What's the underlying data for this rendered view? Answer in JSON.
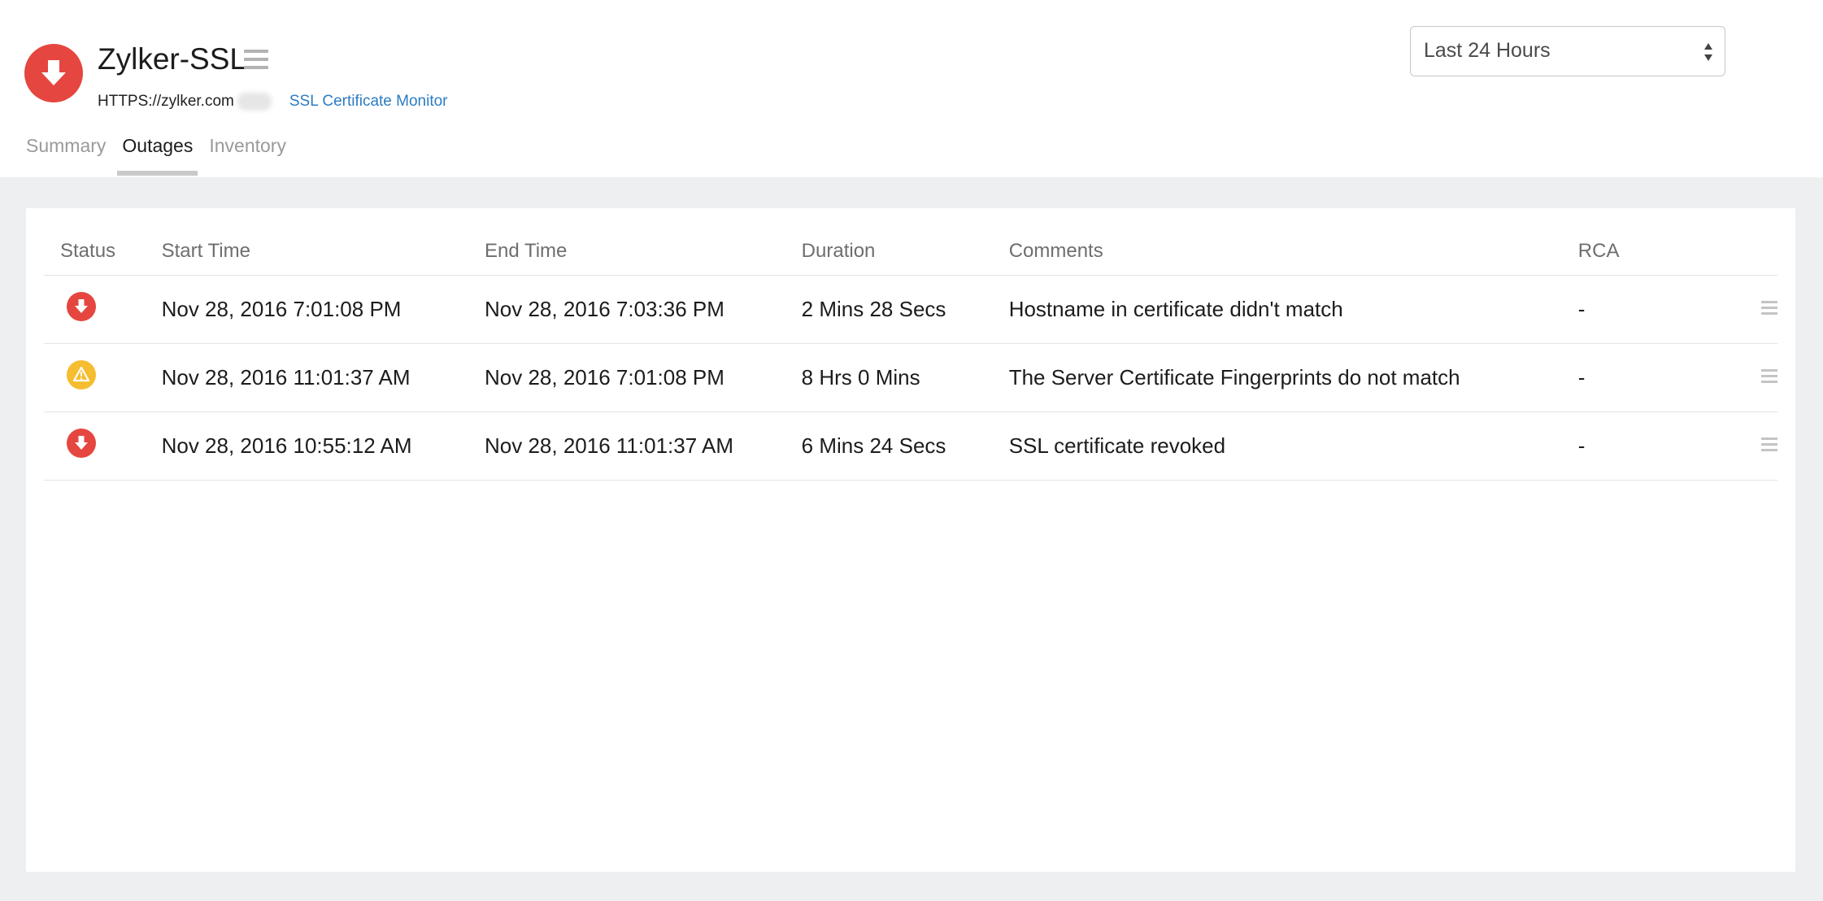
{
  "monitor": {
    "name": "Zylker-SSL",
    "status": "down",
    "status_color": "#e5463f",
    "url": "HTTPS://zylker.com",
    "type": "SSL Certificate Monitor"
  },
  "tabs": [
    {
      "label": "Summary",
      "active": false
    },
    {
      "label": "Outages",
      "active": true
    },
    {
      "label": "Inventory",
      "active": false
    }
  ],
  "period_select": {
    "selected": "Last 24 Hours"
  },
  "table": {
    "columns": [
      "Status",
      "Start Time",
      "End Time",
      "Duration",
      "Comments",
      "RCA"
    ],
    "rows": [
      {
        "status": "down",
        "start": "Nov 28, 2016 7:01:08 PM",
        "end": "Nov 28, 2016 7:03:36 PM",
        "duration": "2 Mins 28 Secs",
        "comment": "Hostname in certificate didn't match",
        "rca": "-"
      },
      {
        "status": "trouble",
        "start": "Nov 28, 2016 11:01:37 AM",
        "end": "Nov 28, 2016 7:01:08 PM",
        "duration": "8 Hrs 0 Mins",
        "comment": "The Server Certificate Fingerprints do not match",
        "rca": "-"
      },
      {
        "status": "down",
        "start": "Nov 28, 2016 10:55:12 AM",
        "end": "Nov 28, 2016 11:01:37 AM",
        "duration": "6 Mins 24 Secs",
        "comment": "SSL certificate revoked",
        "rca": "-"
      }
    ]
  },
  "colors": {
    "down": "#e5463f",
    "trouble": "#f5bd2f",
    "link": "#2c7cc3"
  }
}
